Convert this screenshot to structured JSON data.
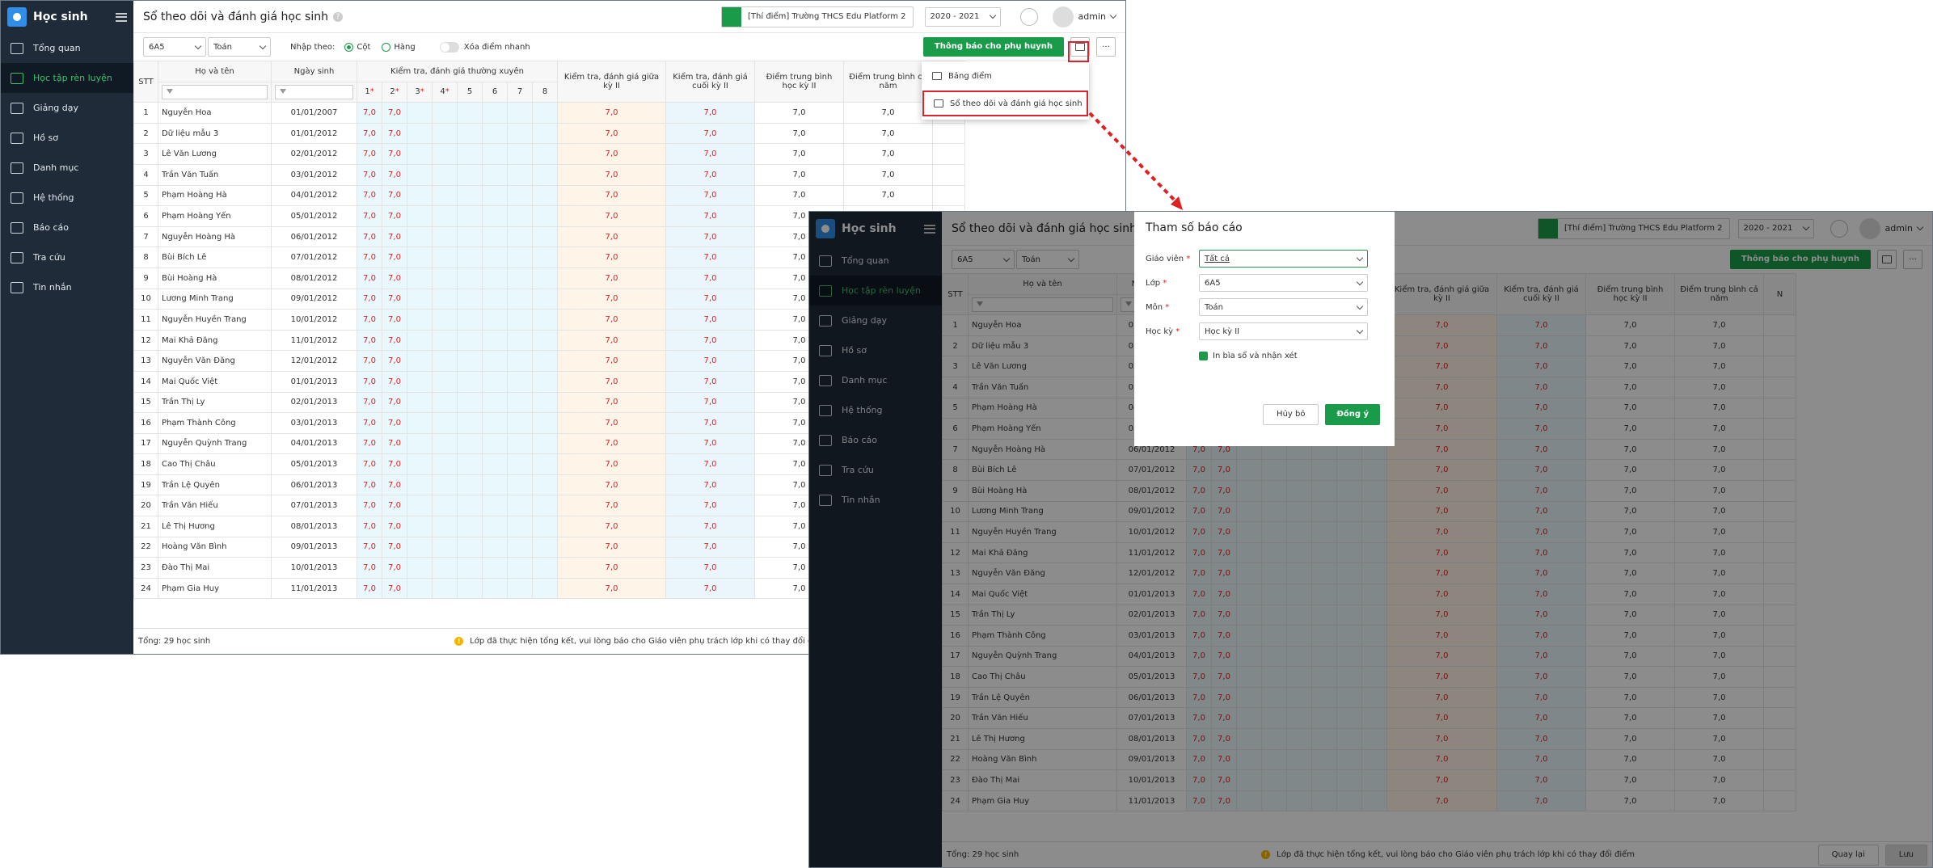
{
  "app": {
    "brand": "Học sinh"
  },
  "nav": [
    {
      "label": "Tổng quan",
      "icon": "chart-icon"
    },
    {
      "label": "Học tập rèn luyện",
      "icon": "book-icon"
    },
    {
      "label": "Giảng dạy",
      "icon": "board-icon"
    },
    {
      "label": "Hồ sơ",
      "icon": "file-icon"
    },
    {
      "label": "Danh mục",
      "icon": "folder-icon"
    },
    {
      "label": "Hệ thống",
      "icon": "gear-icon"
    },
    {
      "label": "Báo cáo",
      "icon": "report-icon"
    },
    {
      "label": "Tra cứu",
      "icon": "search-icon"
    },
    {
      "label": "Tin nhắn",
      "icon": "bell-icon"
    }
  ],
  "header": {
    "title": "Sổ theo dõi và đánh giá học sinh",
    "help": "?",
    "school": "[Thí điểm] Trường THCS Edu Platform 2",
    "year": "2020 - 2021",
    "user": "admin"
  },
  "filters": {
    "class": "6A5",
    "subject": "Toán",
    "input_label": "Nhập theo:",
    "col": "Cột",
    "row": "Hàng",
    "quick_delete": "Xóa điểm nhanh",
    "notify": "Thông báo cho phụ huynh",
    "more": "···"
  },
  "columns": {
    "stt": "STT",
    "name": "Họ và tên",
    "dob": "Ngày sinh",
    "regular": "Kiểm tra, đánh giá thường xuyên",
    "mid": "Kiểm tra, đánh giá giữa kỳ II",
    "end": "Kiểm tra, đánh giá cuối kỳ II",
    "avg2": "Điểm trung bình học kỳ II",
    "avgy": "Điểm trung bình cả năm",
    "n": "N",
    "sub": [
      "1",
      "2",
      "3",
      "4",
      "5",
      "6",
      "7",
      "8"
    ],
    "s1": "Đi"
  },
  "students": [
    [
      "1",
      "Nguyễn Hoa",
      "01/01/2007"
    ],
    [
      "2",
      "Dữ liệu mẫu 3",
      "01/01/2012"
    ],
    [
      "3",
      "Lê Văn Lương",
      "02/01/2012"
    ],
    [
      "4",
      "Trần Văn Tuấn",
      "03/01/2012"
    ],
    [
      "5",
      "Phạm Hoàng Hà",
      "04/01/2012"
    ],
    [
      "6",
      "Phạm Hoàng Yến",
      "05/01/2012"
    ],
    [
      "7",
      "Nguyễn Hoàng Hà",
      "06/01/2012"
    ],
    [
      "8",
      "Bùi Bích Lê",
      "07/01/2012"
    ],
    [
      "9",
      "Bùi Hoàng Hà",
      "08/01/2012"
    ],
    [
      "10",
      "Lương Minh Trang",
      "09/01/2012"
    ],
    [
      "11",
      "Nguyễn Huyền Trang",
      "10/01/2012"
    ],
    [
      "12",
      "Mai Khả Đăng",
      "11/01/2012"
    ],
    [
      "13",
      "Nguyễn Văn Đăng",
      "12/01/2012"
    ],
    [
      "14",
      "Mai Quốc Việt",
      "01/01/2013"
    ],
    [
      "15",
      "Trần Thị Ly",
      "02/01/2013"
    ],
    [
      "16",
      "Phạm Thành Công",
      "03/01/2013"
    ],
    [
      "17",
      "Nguyễn Quỳnh Trang",
      "04/01/2013"
    ],
    [
      "18",
      "Cao Thị Châu",
      "05/01/2013"
    ],
    [
      "19",
      "Trần Lệ Quyên",
      "06/01/2013"
    ],
    [
      "20",
      "Trần Văn Hiếu",
      "07/01/2013"
    ],
    [
      "21",
      "Lê Thị Hương",
      "08/01/2013"
    ],
    [
      "22",
      "Hoàng Văn Bình",
      "09/01/2013"
    ],
    [
      "23",
      "Đào Thị Mai",
      "10/01/2013"
    ],
    [
      "24",
      "Phạm Gia Huy",
      "11/01/2013"
    ]
  ],
  "score": "7,0",
  "footer": {
    "total": "Tổng: 29 học sinh",
    "note": "Lớp đã thực hiện tổng kết, vui lòng báo cho Giáo viên phụ trách lớp khi có thay đổi điểm",
    "back": "Quay lại",
    "save": "Lưu"
  },
  "dropdown": {
    "item1": "Bảng điểm",
    "item2": "Sổ theo dõi và đánh giá học sinh"
  },
  "modal": {
    "title": "Tham số báo cáo",
    "teacher_label": "Giáo viên",
    "teacher": "Tất cả",
    "class_label": "Lớp",
    "class": "6A5",
    "subject_label": "Môn",
    "subject": "Toán",
    "term_label": "Học kỳ",
    "term": "Học kỳ II",
    "print_cover": "In bìa sổ và nhận xét",
    "cancel": "Hủy bỏ",
    "ok": "Đồng ý",
    "req": "*"
  }
}
